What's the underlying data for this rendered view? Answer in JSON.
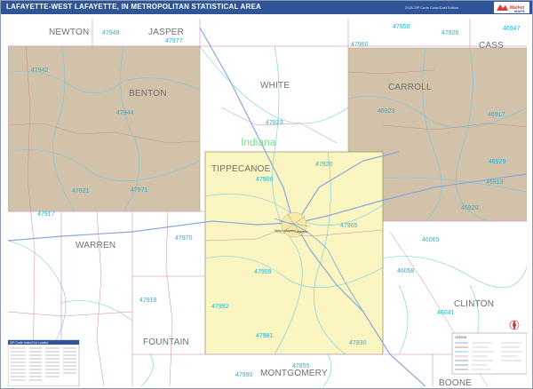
{
  "header": {
    "title": "LAFAYETTE-WEST LAFAYETTE, IN METROPOLITAN STATISTICAL AREA",
    "edition": "2025 ZIP Code Color/Cast Edition",
    "brand": "MarketMAPS"
  },
  "map": {
    "state_label": "Indiana",
    "counties": {
      "newton": "NEWTON",
      "jasper": "JASPER",
      "white": "WHITE",
      "carroll": "CARROLL",
      "cass": "CASS",
      "benton": "BENTON",
      "tippecanoe": "TIPPECANOE",
      "warren": "WARREN",
      "fountain": "FOUNTAIN",
      "montgomery": "MONTGOMERY",
      "clinton": "CLINTON",
      "boone": "BOONE"
    },
    "zips": {
      "z47948": "47948",
      "z47977": "47977",
      "z47960": "47960",
      "z47950": "47950",
      "z47926": "47926",
      "z46947": "46947",
      "z47942": "47942",
      "z47944": "47944",
      "z47923": "47923",
      "z46923": "46923",
      "z46917": "46917",
      "z47920": "47920",
      "z47906": "47906",
      "z47921": "47921",
      "z47971": "47971",
      "z46929": "46929",
      "z46913": "46913",
      "z46920": "46920",
      "z47917": "47917",
      "z47905": "47905",
      "z47970": "47970",
      "z46065": "46065",
      "z47909": "47909",
      "z46058": "46058",
      "z47918": "47918",
      "z47992": "47992",
      "z46041": "46041",
      "z47981": "47981",
      "z47930": "47930",
      "z47855": "47855",
      "z47990": "47990"
    },
    "cities": {
      "lafayette": "Lafayette",
      "west_lafayette": "West Lafayette"
    }
  },
  "index_box": {
    "title": "ZIP Code Index/Out Locator"
  },
  "legend": {
    "title": "LEGEND"
  },
  "colors": {
    "header_bg": "#2f5597",
    "surrounding_msa_fill": "#d2c2aa",
    "tippecanoe_fill": "#fbf5c2",
    "zip_label": "#1cb5d8",
    "zip_boundary": "#6ec9e6",
    "county_line": "#d9a6d2",
    "highway": "#8aa6dd",
    "road": "#c98b8b",
    "state_label": "#7ddc8a"
  }
}
